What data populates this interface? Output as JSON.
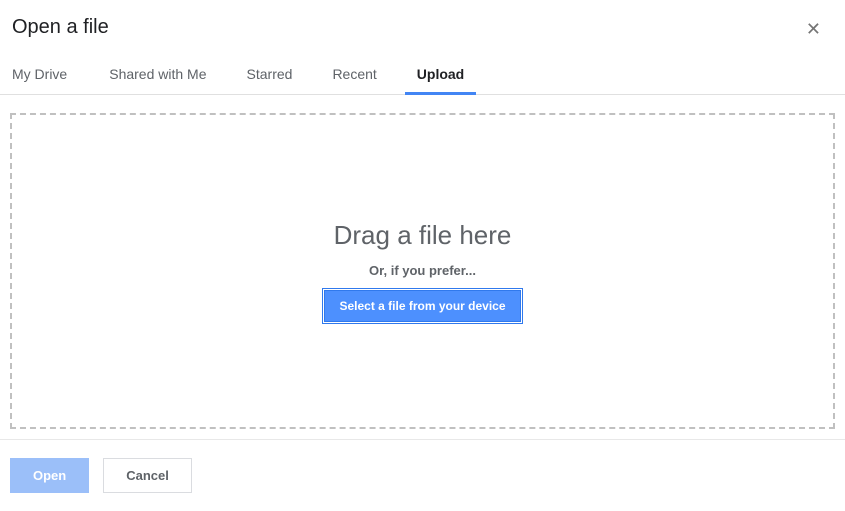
{
  "header": {
    "title": "Open a file"
  },
  "tabs": {
    "items": [
      {
        "label": "My Drive"
      },
      {
        "label": "Shared with Me"
      },
      {
        "label": "Starred"
      },
      {
        "label": "Recent"
      },
      {
        "label": "Upload"
      }
    ],
    "active_index": 4
  },
  "dropzone": {
    "title": "Drag a file here",
    "or_text": "Or, if you prefer...",
    "select_button": "Select a file from your device"
  },
  "footer": {
    "open_label": "Open",
    "cancel_label": "Cancel"
  }
}
